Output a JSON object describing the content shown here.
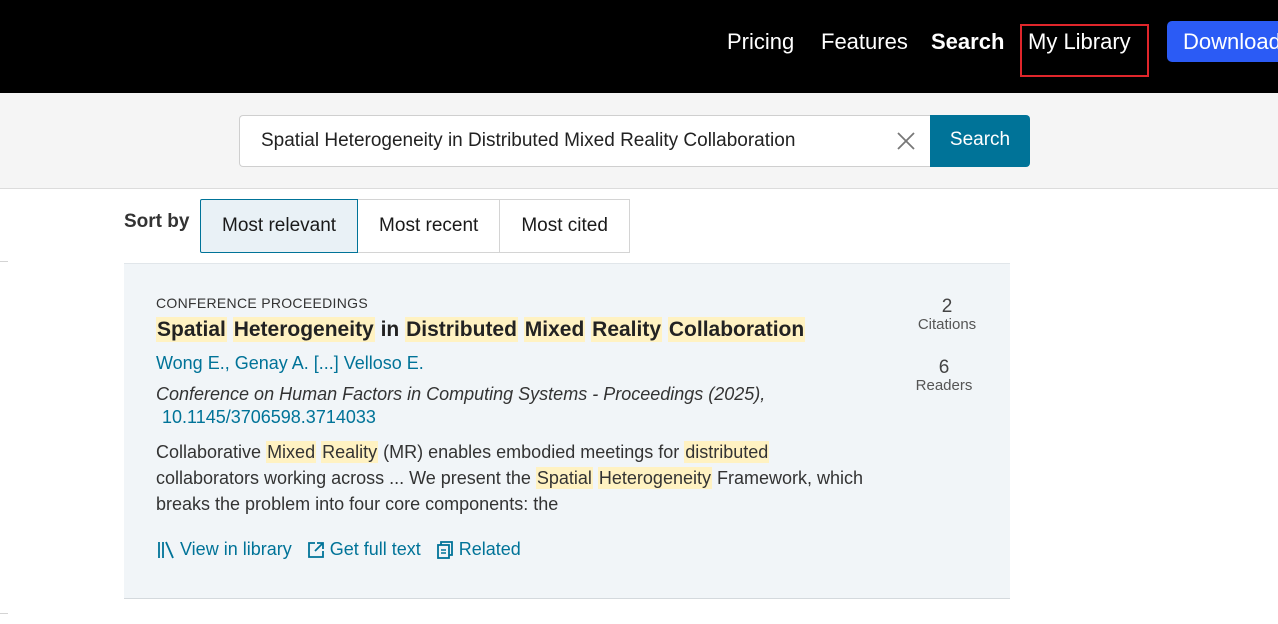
{
  "nav": {
    "pricing": "Pricing",
    "features": "Features",
    "search": "Search",
    "library": "My Library",
    "download": "Download"
  },
  "search": {
    "value": "Spatial Heterogeneity in Distributed Mixed Reality Collaboration",
    "button": "Search"
  },
  "sort": {
    "label": "Sort by",
    "options": [
      "Most relevant",
      "Most recent",
      "Most cited"
    ],
    "active": "Most relevant"
  },
  "result": {
    "type": "CONFERENCE PROCEEDINGS",
    "title_parts": [
      "Spatial",
      "Heterogeneity",
      "in",
      "Distributed",
      "Mixed",
      "Reality",
      "Collaboration"
    ],
    "authors": "Wong E., Genay A. [...] Velloso E.",
    "venue": "Conference on Human Factors in Computing Systems - Proceedings (2025),",
    "doi": "10.1145/3706598.3714033",
    "abstract": {
      "p1": "Collaborative ",
      "h1": "Mixed",
      "p2": " ",
      "h2": "Reality",
      "p3": " (MR) enables embodied meetings for ",
      "h3": "distributed",
      "p4": " collaborators working across ... We present the ",
      "h4": "Spatial",
      "p5": " ",
      "h5": "Heterogeneity",
      "p6": " Framework, which breaks the problem into four core components: the"
    },
    "citations_count": "2",
    "citations_label": "Citations",
    "readers_count": "6",
    "readers_label": "Readers",
    "actions": {
      "view": "View in library",
      "fulltext": "Get full text",
      "related": "Related"
    }
  },
  "colors": {
    "accent": "#007398",
    "highlight": "#fff2c2",
    "download": "#2b5bf5",
    "focus_outline": "#e0262b"
  }
}
